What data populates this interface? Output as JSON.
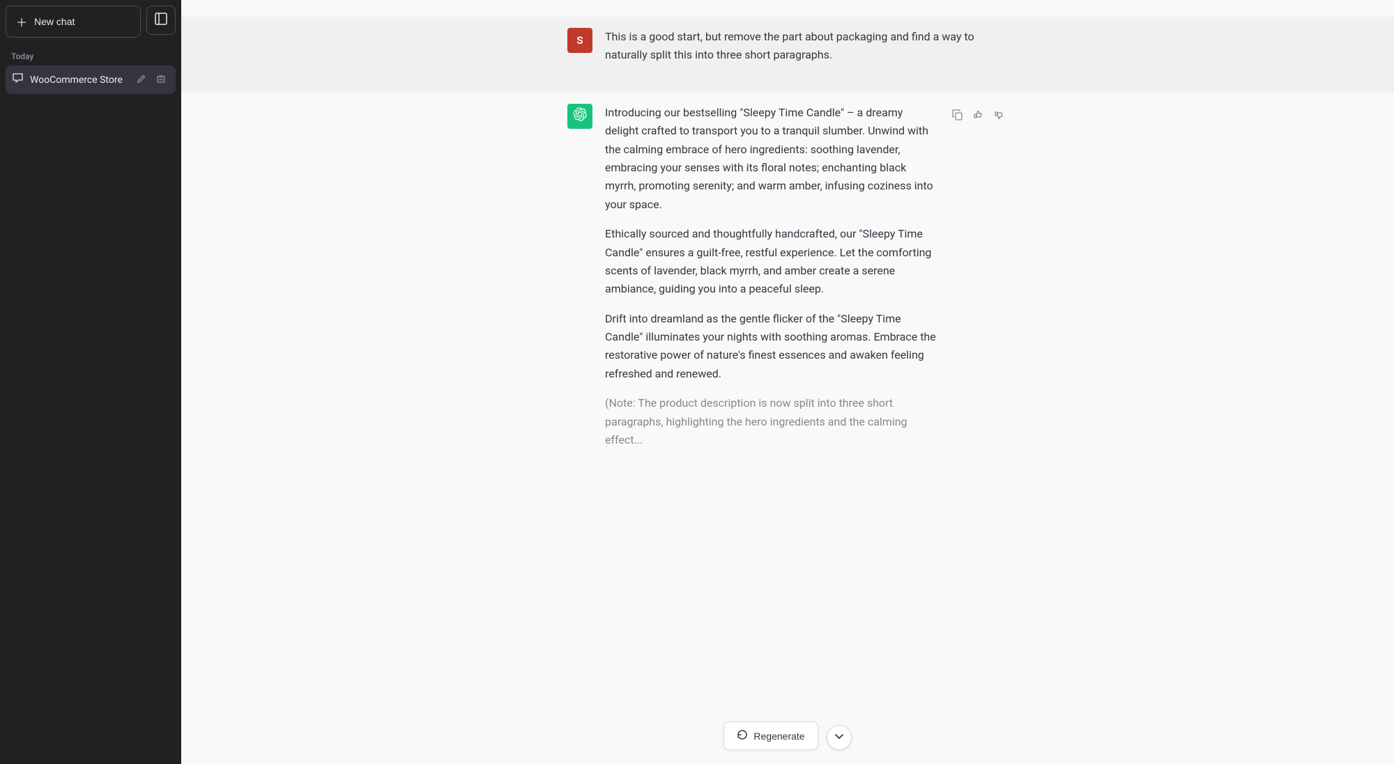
{
  "sidebar": {
    "new_chat_label": "New chat",
    "section_today": "Today",
    "chat_item": {
      "name": "WooCommerce Store",
      "edit_tooltip": "Edit",
      "delete_tooltip": "Delete"
    },
    "toggle_icon": "sidebar-icon"
  },
  "chat": {
    "user_message": {
      "avatar_letter": "S",
      "text": "This is a good start, but remove the part about packaging and find a way to naturally split this into three short paragraphs."
    },
    "ai_message": {
      "paragraphs": [
        "Introducing our bestselling \"Sleepy Time Candle\" – a dreamy delight crafted to transport you to a tranquil slumber. Unwind with the calming embrace of hero ingredients: soothing lavender, embracing your senses with its floral notes; enchanting black myrrh, promoting serenity; and warm amber, infusing coziness into your space.",
        "Ethically sourced and thoughtfully handcrafted, our \"Sleepy Time Candle\" ensures a guilt-free, restful experience. Let the comforting scents of lavender, black myrrh, and amber create a serene ambiance, guiding you into a peaceful sleep.",
        "Drift into dreamland as the gentle flicker of the \"Sleepy Time Candle\" illuminates your nights with soothing aromas. Embrace the restorative power of nature's finest essences and awaken feeling refreshed and renewed.",
        "(Note: The product description is now split into three short paragraphs, highlighting the hero ingredients and the calming effect..."
      ],
      "actions": {
        "copy": "copy-icon",
        "thumbup": "thumbs-up-icon",
        "thumbdown": "thumbs-down-icon"
      }
    }
  },
  "bottom": {
    "regenerate_label": "Regenerate",
    "scroll_down_label": "scroll down"
  },
  "colors": {
    "user_avatar_bg": "#c0392b",
    "ai_avatar_bg": "#19c37d",
    "sidebar_bg": "#202123",
    "active_chat_bg": "#343541"
  }
}
